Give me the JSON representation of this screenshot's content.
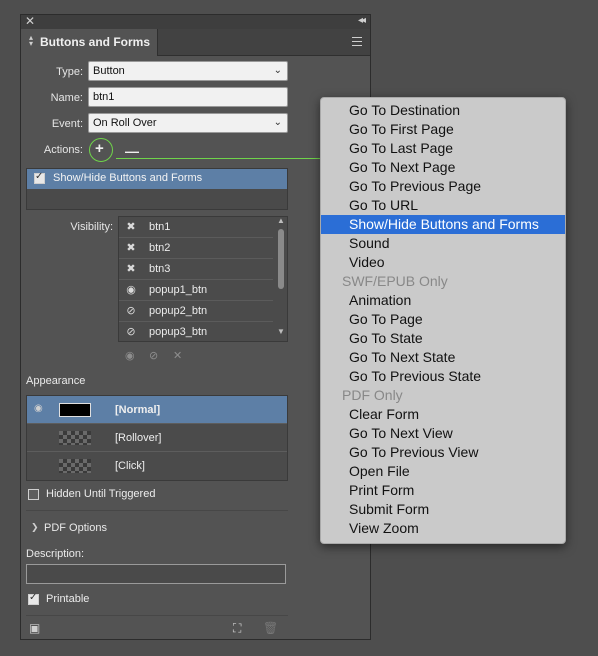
{
  "panel": {
    "title": "Buttons and Forms",
    "type_label": "Type:",
    "type_value": "Button",
    "name_label": "Name:",
    "name_value": "btn1",
    "event_label": "Event:",
    "event_value": "On Roll Over",
    "actions_label": "Actions:",
    "action_item": "Show/Hide Buttons and Forms",
    "action_checked": true,
    "visibility_label": "Visibility:",
    "visibility_items": [
      {
        "icon": "x-icon",
        "name": "btn1"
      },
      {
        "icon": "x-icon",
        "name": "btn2"
      },
      {
        "icon": "x-icon",
        "name": "btn3"
      },
      {
        "icon": "eye-icon",
        "name": "popup1_btn"
      },
      {
        "icon": "eye-slash-icon",
        "name": "popup2_btn"
      },
      {
        "icon": "eye-slash-icon",
        "name": "popup3_btn"
      }
    ],
    "appearance_label": "Appearance",
    "appearance_states": [
      "[Normal]",
      "[Rollover]",
      "[Click]"
    ],
    "hidden_label": "Hidden Until Triggered",
    "hidden_checked": false,
    "pdf_options_label": "PDF Options",
    "description_label": "Description:",
    "description_value": "",
    "printable_label": "Printable",
    "printable_checked": true
  },
  "menu": {
    "items": [
      {
        "label": "Go To Destination",
        "kind": "item"
      },
      {
        "label": "Go To First Page",
        "kind": "item"
      },
      {
        "label": "Go To Last Page",
        "kind": "item"
      },
      {
        "label": "Go To Next Page",
        "kind": "item"
      },
      {
        "label": "Go To Previous Page",
        "kind": "item"
      },
      {
        "label": "Go To URL",
        "kind": "item"
      },
      {
        "label": "Show/Hide Buttons and Forms",
        "kind": "selected"
      },
      {
        "label": "Sound",
        "kind": "item"
      },
      {
        "label": "Video",
        "kind": "item"
      },
      {
        "label": "SWF/EPUB Only",
        "kind": "header"
      },
      {
        "label": "Animation",
        "kind": "item"
      },
      {
        "label": "Go To Page",
        "kind": "item"
      },
      {
        "label": "Go To State",
        "kind": "item"
      },
      {
        "label": "Go To Next State",
        "kind": "item"
      },
      {
        "label": "Go To Previous State",
        "kind": "item"
      },
      {
        "label": "PDF Only",
        "kind": "header"
      },
      {
        "label": "Clear Form",
        "kind": "item"
      },
      {
        "label": "Go To Next View",
        "kind": "item"
      },
      {
        "label": "Go To Previous View",
        "kind": "item"
      },
      {
        "label": "Open File",
        "kind": "item"
      },
      {
        "label": "Print Form",
        "kind": "item"
      },
      {
        "label": "Submit Form",
        "kind": "item"
      },
      {
        "label": "View Zoom",
        "kind": "item"
      }
    ]
  },
  "colors": {
    "selection": "#2b6ed6",
    "panel_selection": "#5d7fa6",
    "callout": "#6fd44a"
  }
}
